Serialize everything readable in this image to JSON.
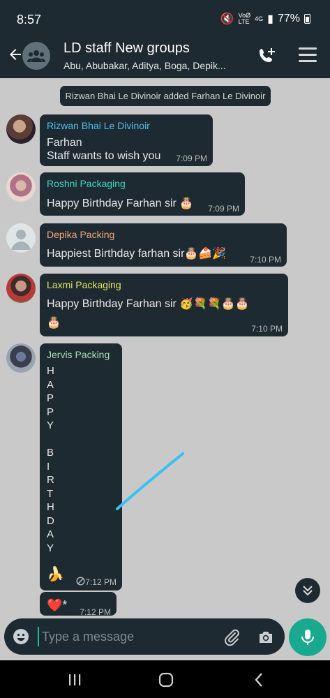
{
  "status_bar": {
    "time": "8:57",
    "network_label_top": "VoØ",
    "network_label_bottom": "LTE",
    "sim_label": "4G",
    "battery": "77%"
  },
  "chat_header": {
    "title": "LD staff New groups",
    "subtitle": "Abu, Abubakar, Aditya, Boga, Depik..."
  },
  "system_message": "Rizwan Bhai Le Divinoir added Farhan Le Divinoir",
  "messages": [
    {
      "sender": "Rizwan Bhai Le Divinoir",
      "sender_color": "#53bdeb",
      "lines": [
        "Farhan",
        "Staff wants to wish you"
      ],
      "time": "7:09 PM"
    },
    {
      "sender": "Roshni Packaging",
      "sender_color": "#3dd6c6",
      "text": "Happy Birthday Farhan sir 🎂",
      "time": "7:09 PM"
    },
    {
      "sender": "Depika Packing",
      "sender_color": "#f2a57a",
      "text": "Happiest Birthday farhan sir🎂🍰🎉",
      "time": "7:10 PM"
    },
    {
      "sender": "Laxmi Packaging",
      "sender_color": "#e2e362",
      "lines": [
        "Happy Birthday Farhan sir 🥳💐💐🎂🎂",
        "🎂"
      ],
      "time": "7:10 PM"
    },
    {
      "sender": "Jervis Packing",
      "sender_color": "#a4e0b0",
      "letters": [
        "H",
        "A",
        "P",
        "P",
        "Y",
        "",
        "B",
        "I",
        "R",
        "T",
        "H",
        "D",
        "A",
        "Y"
      ],
      "emoji": "🍌",
      "time": "7:12 PM"
    },
    {
      "text": "❤️*",
      "time": "7:12 PM"
    }
  ],
  "composer": {
    "placeholder": "Type a message"
  },
  "colors": {
    "header_bg": "#1e2a31",
    "bubble_bg": "#1e2a31",
    "chat_bg": "#c9c9c9",
    "accent": "#19a98f",
    "scribble": "#3cc0f0"
  }
}
